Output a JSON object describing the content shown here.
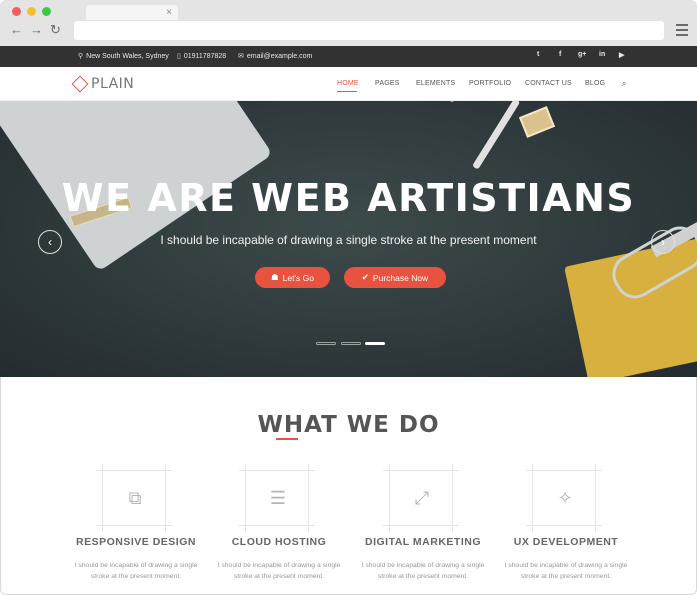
{
  "browser": {
    "tab_close": "×",
    "back": "←",
    "forward": "→",
    "reload": "↻"
  },
  "infobar": {
    "location": "New South Wales, Sydney",
    "phone": "01911787828",
    "email": "email@example.com",
    "social": [
      "t",
      "f",
      "g+",
      "in",
      "▶"
    ]
  },
  "nav": {
    "logo": "PLAIN",
    "items": [
      "HOME",
      "PAGES",
      "ELEMENTS",
      "PORTFOLIO",
      "CONTACT US",
      "BLOG"
    ],
    "search_icon": "⌕"
  },
  "hero": {
    "title": "WE ARE WEB ARTISTIANS",
    "subtitle": "I should be incapable of drawing a single stroke at the present moment",
    "btn_go": "Let's Go",
    "btn_buy": "Purchase Now",
    "prev": "‹",
    "next": "›",
    "active_slide": 3,
    "slides": 3
  },
  "services": {
    "title": "WHAT WE DO",
    "items": [
      {
        "title": "RESPONSIVE DESIGN",
        "text": "I should be incapable of drawing a single stroke at the present moment.",
        "icon": "devices-icon"
      },
      {
        "title": "CLOUD HOSTING",
        "text": "I should be incapable of drawing a single stroke at the present moment.",
        "icon": "server-icon"
      },
      {
        "title": "DIGITAL MARKETING",
        "text": "I should be incapable of drawing a single stroke at the present moment.",
        "icon": "expand-icon"
      },
      {
        "title": "UX DEVELOPMENT",
        "text": "I should be incapable of drawing a single stroke at the present moment.",
        "icon": "magic-wand-icon"
      }
    ]
  },
  "colors": {
    "accent": "#e8533f",
    "topbar": "#323232",
    "hero": "#2f3a3c"
  }
}
